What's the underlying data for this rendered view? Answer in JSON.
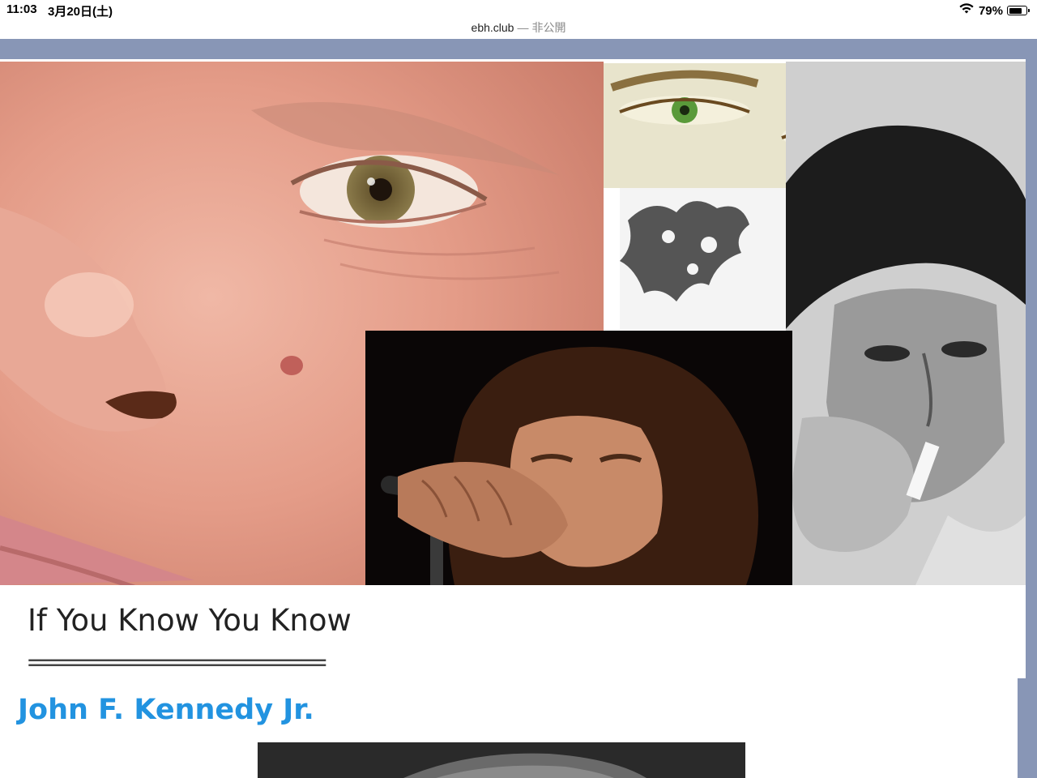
{
  "status_bar": {
    "time": "11:03",
    "date": "3月20日(土)",
    "battery_percent": "79%",
    "battery_level": 0.79,
    "url_host": "ebh.club",
    "url_separator": "—",
    "url_status": "非公開"
  },
  "article": {
    "heading": "If You Know You Know",
    "divider": "==========================",
    "subject_link": "John F. Kennedy Jr."
  },
  "icons": {
    "wifi": "wifi-icon",
    "battery": "battery-icon"
  },
  "colors": {
    "page_background": "#8896b6",
    "link": "#2293e0"
  }
}
